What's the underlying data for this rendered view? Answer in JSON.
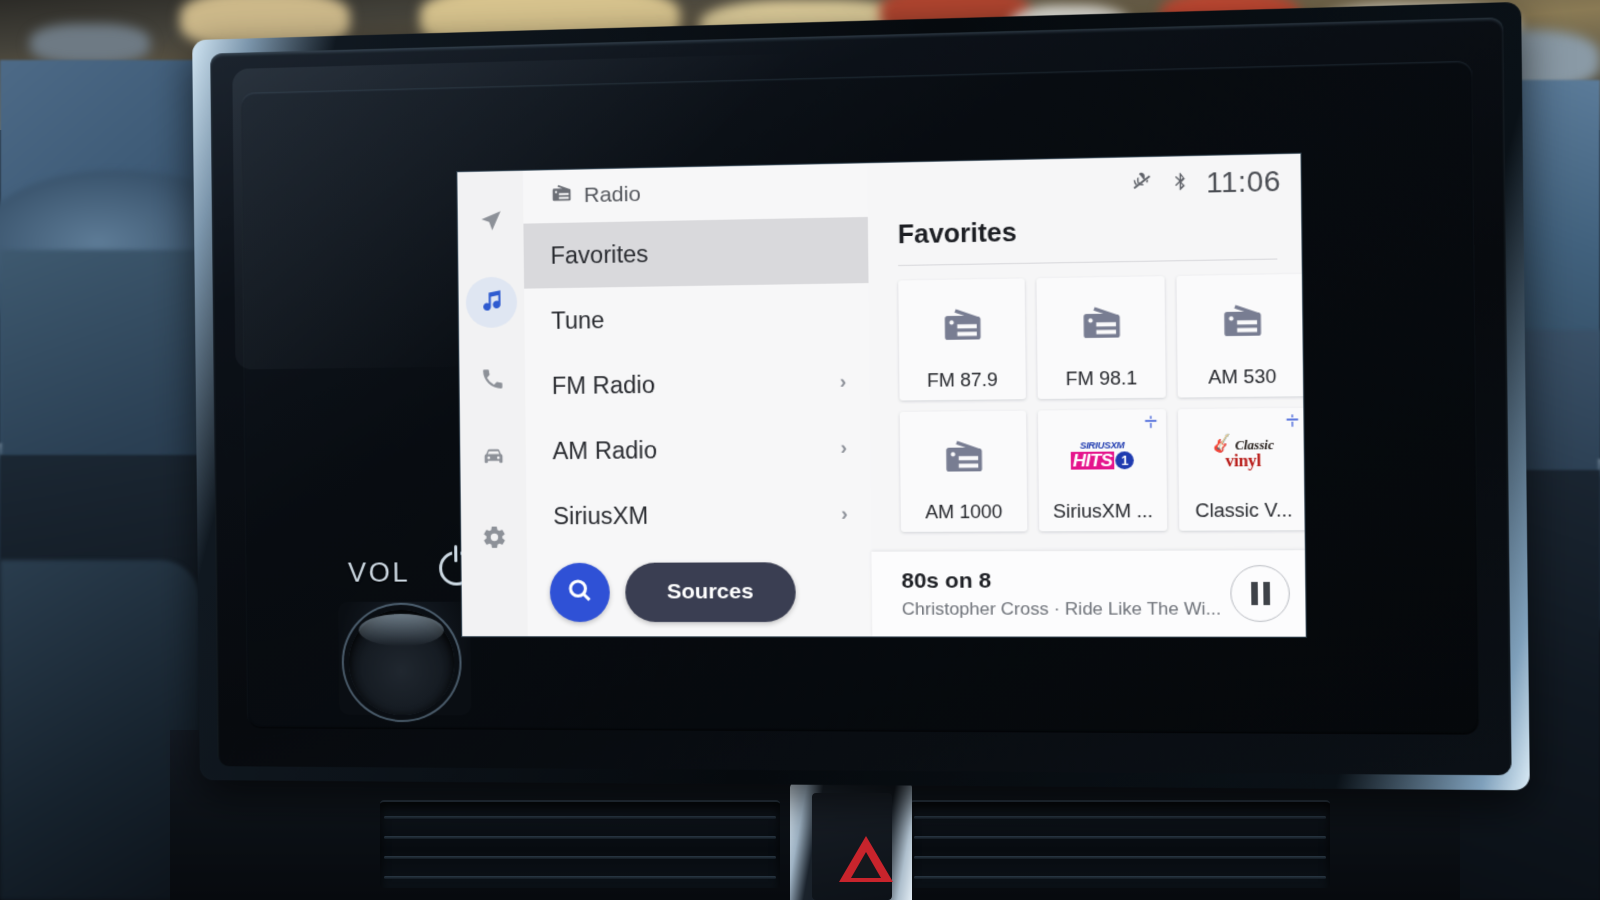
{
  "device": {
    "name": "car-infotainment-head-unit",
    "vol_label": "VOL",
    "power_icon": "power-icon",
    "knob": "volume-knob",
    "hazard_icon": "hazard-triangle-icon"
  },
  "rail": {
    "items": [
      {
        "name": "navigation",
        "icon": "navigation-arrow-icon",
        "active": false
      },
      {
        "name": "media",
        "icon": "music-note-icon",
        "active": true
      },
      {
        "name": "phone",
        "icon": "phone-icon",
        "active": false
      },
      {
        "name": "vehicle",
        "icon": "car-icon",
        "active": false
      },
      {
        "name": "settings",
        "icon": "gear-icon",
        "active": false
      }
    ]
  },
  "source_panel": {
    "header_icon": "radio-icon",
    "header_title": "Radio",
    "items": [
      {
        "label": "Favorites",
        "selected": true,
        "chevron": ""
      },
      {
        "label": "Tune",
        "selected": false,
        "chevron": ""
      },
      {
        "label": "FM Radio",
        "selected": false,
        "chevron": "›"
      },
      {
        "label": "AM Radio",
        "selected": false,
        "chevron": "›"
      },
      {
        "label": "SiriusXM",
        "selected": false,
        "chevron": "›"
      }
    ],
    "search_icon": "search-icon",
    "sources_label": "Sources"
  },
  "status_bar": {
    "mic_muted_icon": "microphone-muted-icon",
    "bluetooth_icon": "bluetooth-icon",
    "time": "11:06"
  },
  "content": {
    "title": "Favorites",
    "tiles": [
      {
        "label": "FM 87.9",
        "icon": "radio-icon",
        "sxm": false
      },
      {
        "label": "FM 98.1",
        "icon": "radio-icon",
        "sxm": false
      },
      {
        "label": "AM 530",
        "icon": "radio-icon",
        "sxm": false
      },
      {
        "label": "AM 1000",
        "icon": "radio-icon",
        "sxm": false
      },
      {
        "label": "SiriusXM ...",
        "icon": "siriusxm-hits1-logo",
        "sxm": true
      },
      {
        "label": "Classic V...",
        "icon": "classic-vinyl-logo",
        "sxm": true
      }
    ]
  },
  "now_playing": {
    "channel": "80s on 8",
    "track": "Christopher Cross · Ride Like The Wi...",
    "transport_icon": "pause-icon"
  },
  "colors": {
    "accent_blue": "#2f51d6",
    "sources_navy": "#3a3e52",
    "selected_row": "#d9d9dc",
    "screen_bg": "#f6f6f7",
    "icon_gray": "#787d92"
  }
}
